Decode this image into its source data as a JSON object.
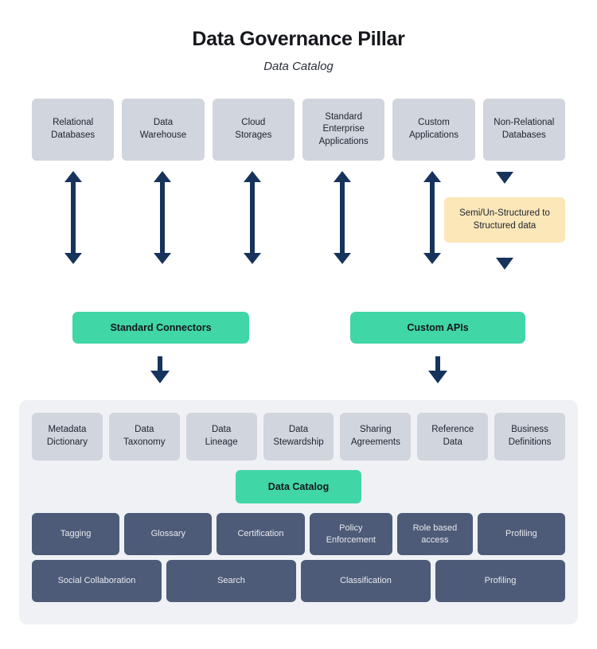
{
  "header": {
    "title": "Data Governance Pillar",
    "subtitle": "Data Catalog"
  },
  "sources": {
    "items": [
      {
        "label": "Relational\nDatabases"
      },
      {
        "label": "Data\nWarehouse"
      },
      {
        "label": "Cloud\nStorages"
      },
      {
        "label": "Standard\nEnterprise\nApplications"
      },
      {
        "label": "Custom\nApplications"
      },
      {
        "label": "Non-Relational\nDatabases"
      }
    ]
  },
  "transform": {
    "label": "Semi/Un-Structured to\nStructured data"
  },
  "connectors": {
    "standard_label": "Standard Connectors",
    "custom_label": "Custom APIs"
  },
  "panel": {
    "capabilities": [
      {
        "label": "Metadata\nDictionary"
      },
      {
        "label": "Data\nTaxonomy"
      },
      {
        "label": "Data\nLineage"
      },
      {
        "label": "Data\nStewardship"
      },
      {
        "label": "Sharing\nAgreements"
      },
      {
        "label": "Reference\nData"
      },
      {
        "label": "Business\nDefinitions"
      }
    ],
    "catalog_badge": "Data Catalog",
    "features_primary": [
      {
        "label": "Tagging"
      },
      {
        "label": "Glossary"
      },
      {
        "label": "Certification"
      },
      {
        "label": "Policy\nEnforcement"
      },
      {
        "label": "Role based\naccess"
      },
      {
        "label": "Profiling"
      }
    ],
    "features_secondary": [
      {
        "label": "Social Collaboration"
      },
      {
        "label": "Search"
      },
      {
        "label": "Classification"
      },
      {
        "label": "Profiling"
      }
    ]
  },
  "colors": {
    "source_box": "#d1d5dd",
    "accent_green": "#41d6a6",
    "transform_yellow": "#fbe7b8",
    "feature_slate": "#4d5b78",
    "arrow_navy": "#16335c",
    "panel_bg": "#eff1f5"
  }
}
